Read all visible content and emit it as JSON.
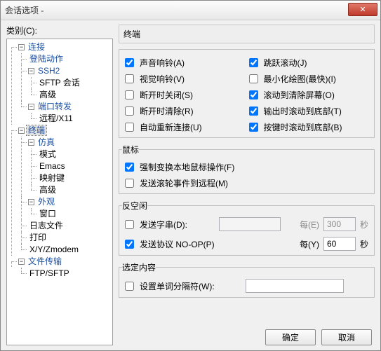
{
  "window": {
    "title": "会话选项 -"
  },
  "left": {
    "label": "类别(C):"
  },
  "tree": {
    "n0": "连接",
    "n0_0": "登陆动作",
    "n0_1": "SSH2",
    "n0_1_0": "SFTP 会话",
    "n0_1_1": "高级",
    "n0_2": "端口转发",
    "n0_2_0": "远程/X11",
    "n1": "终端",
    "n1_0": "仿真",
    "n1_0_0": "模式",
    "n1_0_1": "Emacs",
    "n1_0_2": "映射键",
    "n1_0_3": "高级",
    "n1_1": "外观",
    "n1_1_0": "窗口",
    "n1_2": "日志文件",
    "n1_3": "打印",
    "n1_4": "X/Y/Zmodem",
    "n2": "文件传输",
    "n2_0": "FTP/SFTP"
  },
  "panel": {
    "title": "终端"
  },
  "cb": {
    "audio": "声音响铃(A)",
    "visual": "视觉响铃(V)",
    "closeOnDisc": "断开时关闭(S)",
    "clearOnDisc": "断开时清除(R)",
    "autoReconn": "自动重新连接(U)",
    "jumpScroll": "跳跃滚动(J)",
    "minDraw": "最小化绘图(最快)(I)",
    "scrollClear": "滚动到清除屏幕(O)",
    "scrollOut": "输出时滚动到底部(T)",
    "scrollKey": "按键时滚动到底部(B)"
  },
  "mouse": {
    "legend": "鼠标",
    "force": "强制变换本地鼠标操作(F)",
    "sendWheel": "发送滚轮事件到远程(M)"
  },
  "idle": {
    "legend": "反空闲",
    "sendStr": "发送字串(D):",
    "sendProto": "发送协议 NO-OP(P)",
    "everyE": "每(E)",
    "everyY": "每(Y)",
    "sec": "秒",
    "val300": "300",
    "val60": "60"
  },
  "sel": {
    "legend": "选定内容",
    "setDelim": "设置单词分隔符(W):",
    "value": ""
  },
  "buttons": {
    "ok": "确定",
    "cancel": "取消"
  },
  "glyph": {
    "minus": "−",
    "x": "✕"
  }
}
